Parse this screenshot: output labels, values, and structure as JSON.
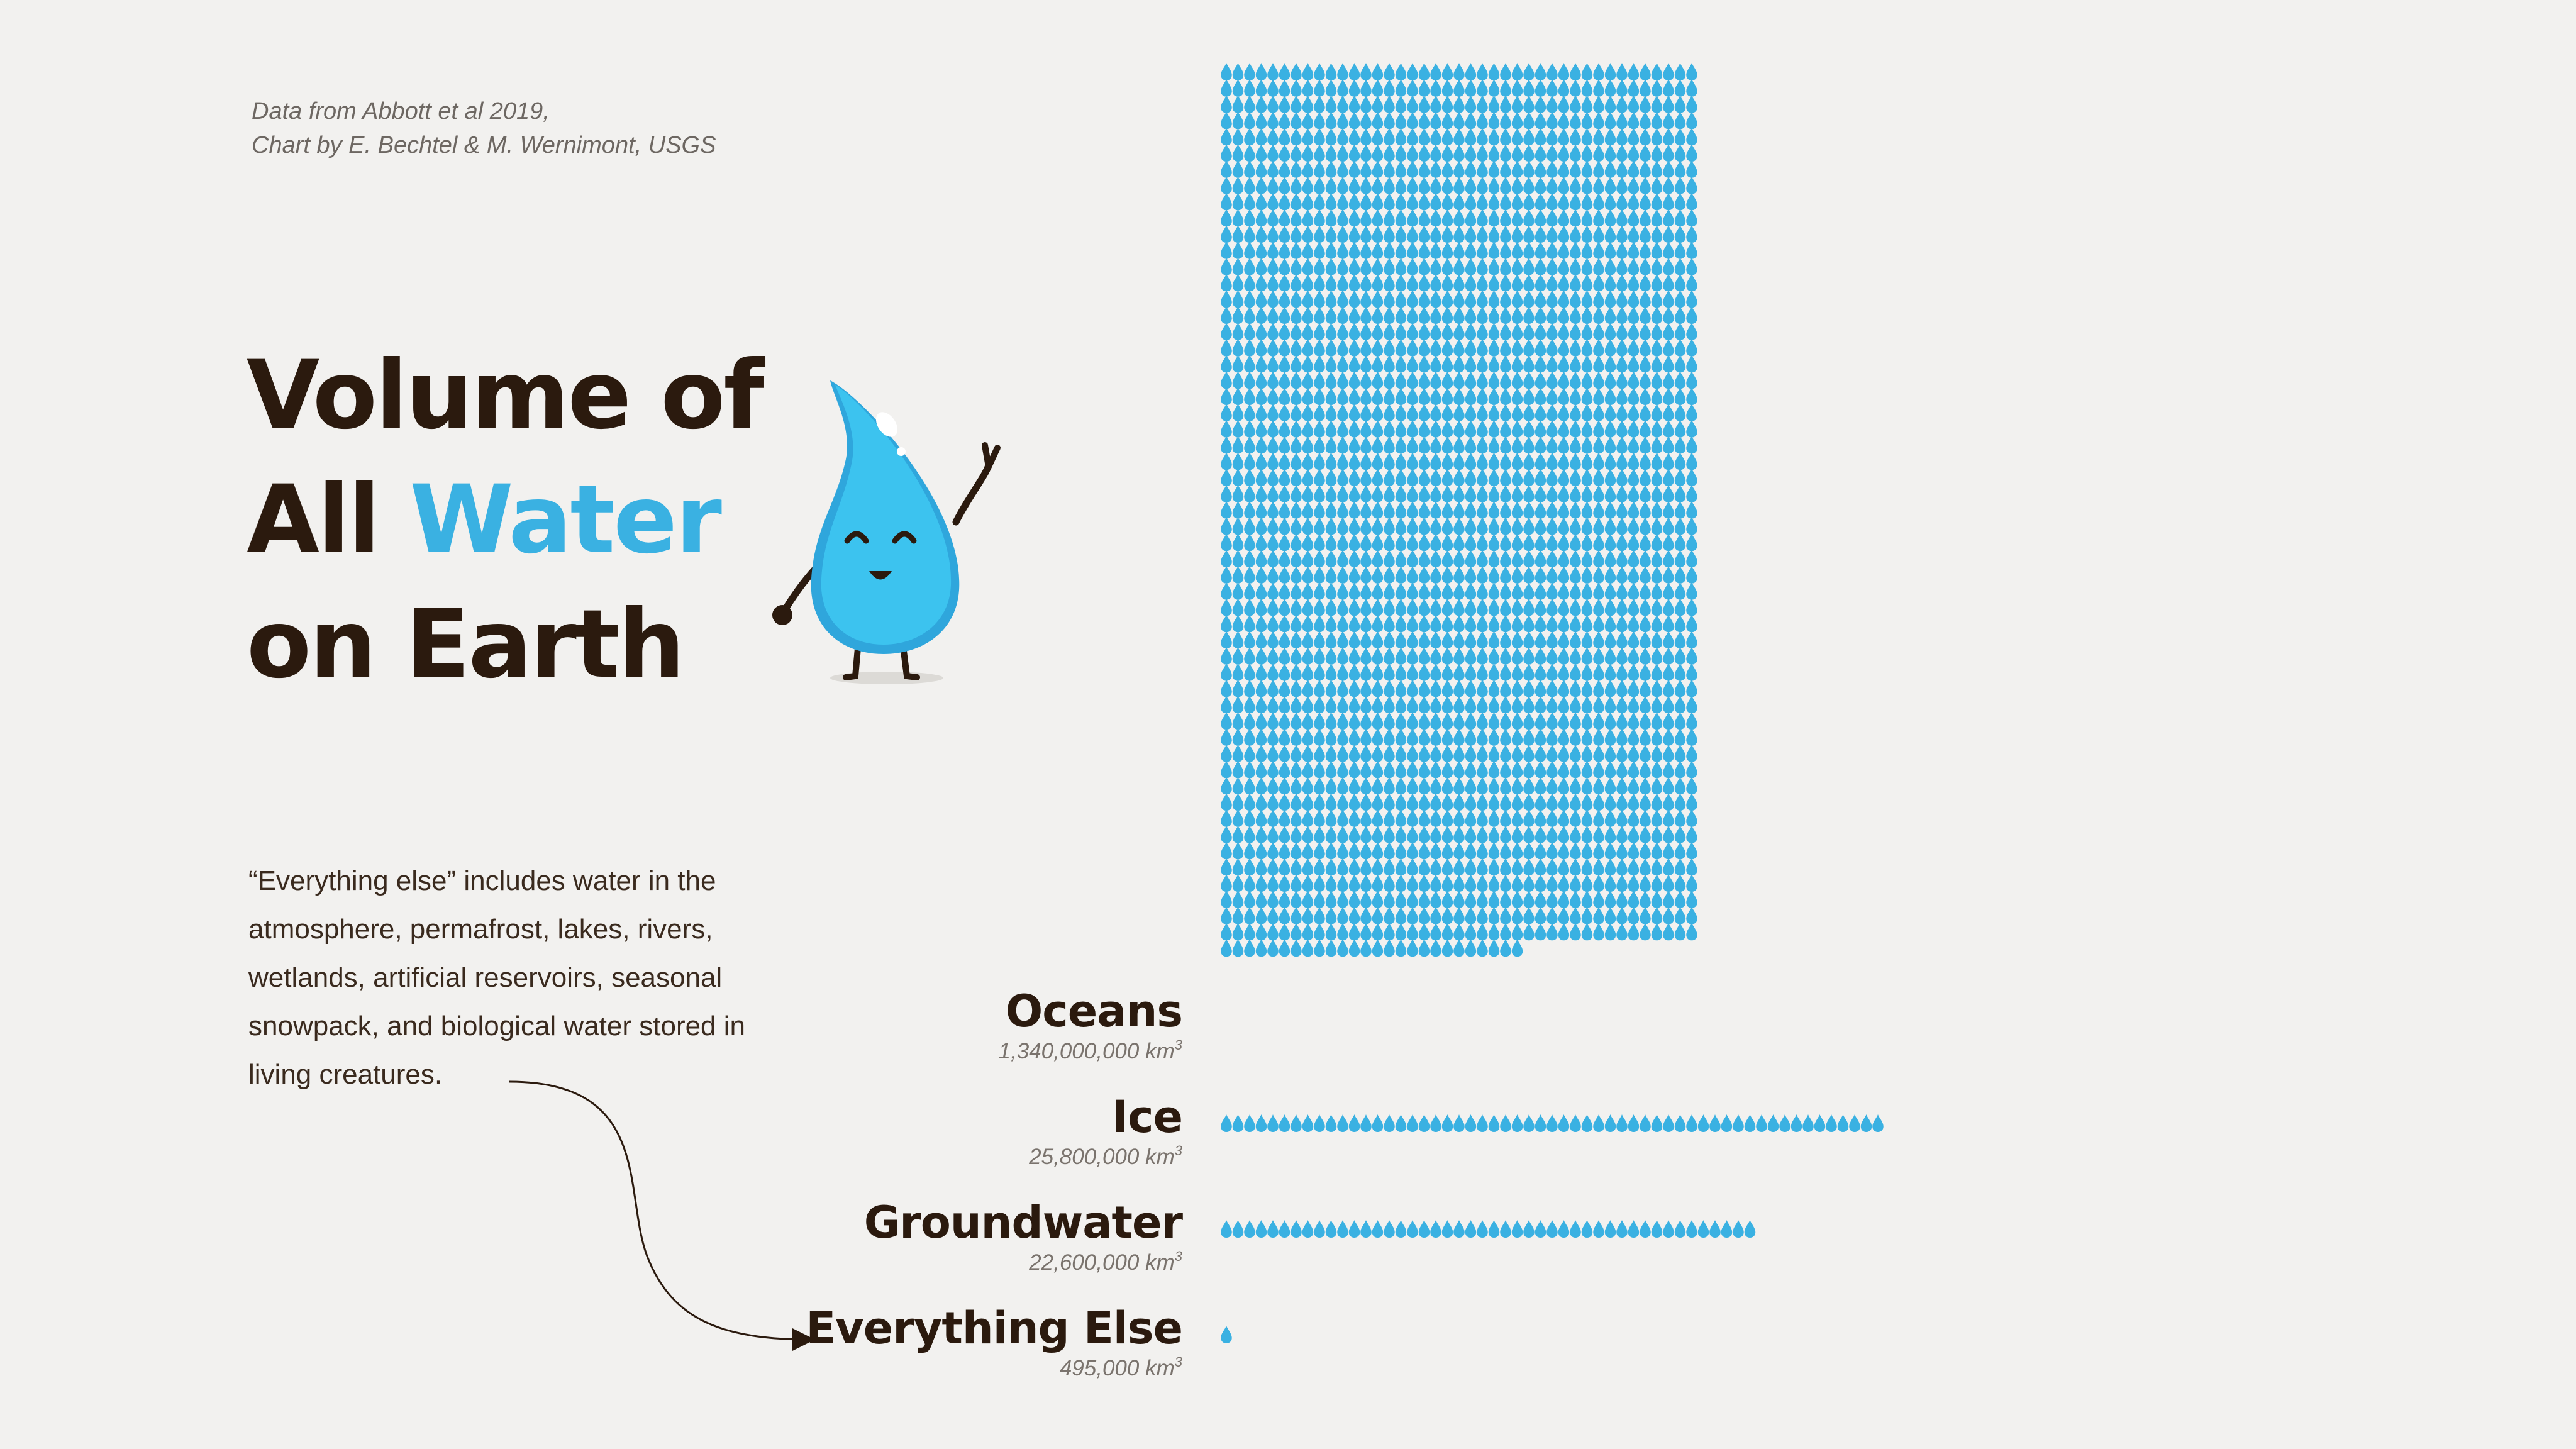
{
  "credit": {
    "line1": "Data from Abbott et al 2019,",
    "line2": "Chart by E. Bechtel & M. Wernimont, USGS"
  },
  "title": {
    "line1": "Volume of",
    "line2_prefix": "All ",
    "line2_accent": "Water",
    "line3": "on Earth"
  },
  "note": "“Everything else” includes water in the atmosphere, permafrost, lakes, rivers, wetlands, artificial reservoirs, seasonal snowpack, and biological water stored in living creatures.",
  "colors": {
    "drop": "#3ab1e2",
    "text": "#2b1a0e",
    "background": "#f2f1ef"
  },
  "icons": {
    "unit": "water-drop-icon",
    "mascot": "water-drop-mascot"
  },
  "chart_data": {
    "type": "pictogram",
    "unit_label": "km",
    "unit_exponent": "3",
    "categories": [
      "Oceans",
      "Ice",
      "Groundwater",
      "Everything Else"
    ],
    "value_labels": [
      "1,340,000,000",
      "25,800,000",
      "22,600,000",
      "495,000"
    ],
    "values": [
      1340000000,
      25800000,
      22600000,
      495000
    ],
    "approx_drop_counts": [
      2240,
      57,
      46,
      1
    ],
    "grid": false,
    "legend": "none"
  }
}
